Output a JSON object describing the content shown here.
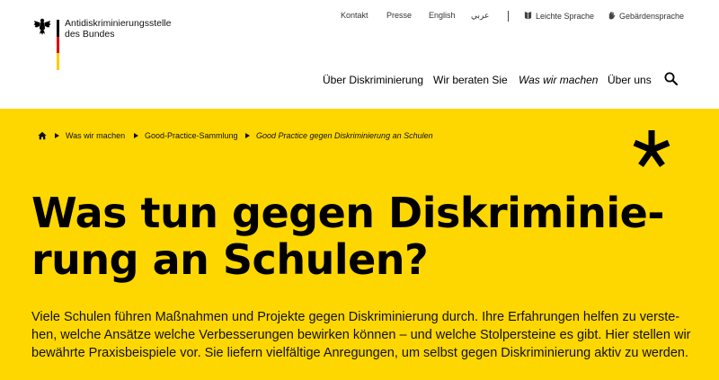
{
  "logo": {
    "line1": "Antidiskriminierungsstelle",
    "line2": "des Bundes",
    "flag_colors": [
      "#000000",
      "#dd0000",
      "#ffcc00"
    ]
  },
  "meta_nav": {
    "kontakt": "Kontakt",
    "presse": "Presse",
    "english": "English",
    "arabic": "عربي",
    "leichte_sprache": "Leichte Sprache",
    "gebaerdensprache": "Gebärdensprache"
  },
  "main_nav": {
    "items": [
      "Über Diskriminierung",
      "Wir beraten Sie",
      "Was wir machen",
      "Über uns"
    ],
    "current": "Was wir machen"
  },
  "breadcrumb": {
    "items": [
      "Was wir machen",
      "Good-Practice-Sammlung",
      "Good Practice gegen Diskriminierung an Schulen"
    ]
  },
  "page": {
    "title_line1": "Was tun gegen Diskriminie-",
    "title_line2": "rung an Schulen?",
    "intro_line1": "Viele Schulen führen Maßnahmen und Projekte gegen Diskriminierung durch. Ihre Erfahrungen helfen zu verste-",
    "intro_line2": "hen, welche Ansätze welche Verbesserungen bewirken können – und welche Stolpersteine es gibt. Hier stellen wir",
    "intro_line3": "bewährte Praxisbeispiele vor. Sie liefern vielfältige Anregungen, um selbst gegen Diskriminierung aktiv zu werden."
  },
  "colors": {
    "accent_yellow": "#ffd700"
  },
  "icons": {
    "brand": "federal-eagle-icon",
    "leichte_sprache": "book-icon",
    "gebaerdensprache": "hand-icon",
    "search": "search-icon",
    "home": "home-icon",
    "decor": "asterisk-icon"
  }
}
